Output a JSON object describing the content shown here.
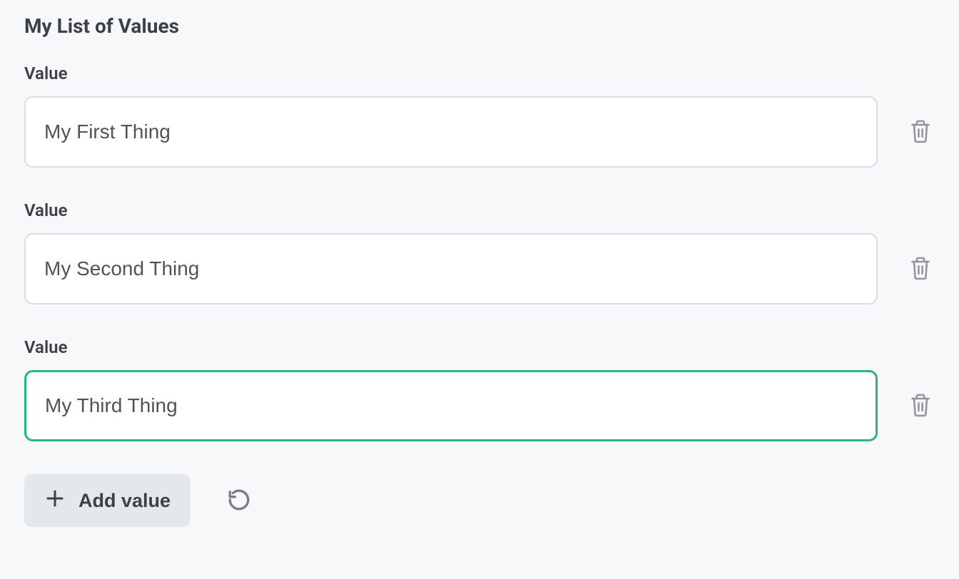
{
  "title": "My List of Values",
  "field_label": "Value",
  "items": [
    {
      "value": "My First Thing",
      "focused": false
    },
    {
      "value": "My Second Thing",
      "focused": false
    },
    {
      "value": "My Third Thing",
      "focused": true
    }
  ],
  "add_button_label": "Add value",
  "colors": {
    "focus_border": "#28b779",
    "input_border": "#d9dde1",
    "text": "#3c4149",
    "icon": "#93959f",
    "bg": "#f7f8f9",
    "add_bg": "#e5e8eb"
  }
}
